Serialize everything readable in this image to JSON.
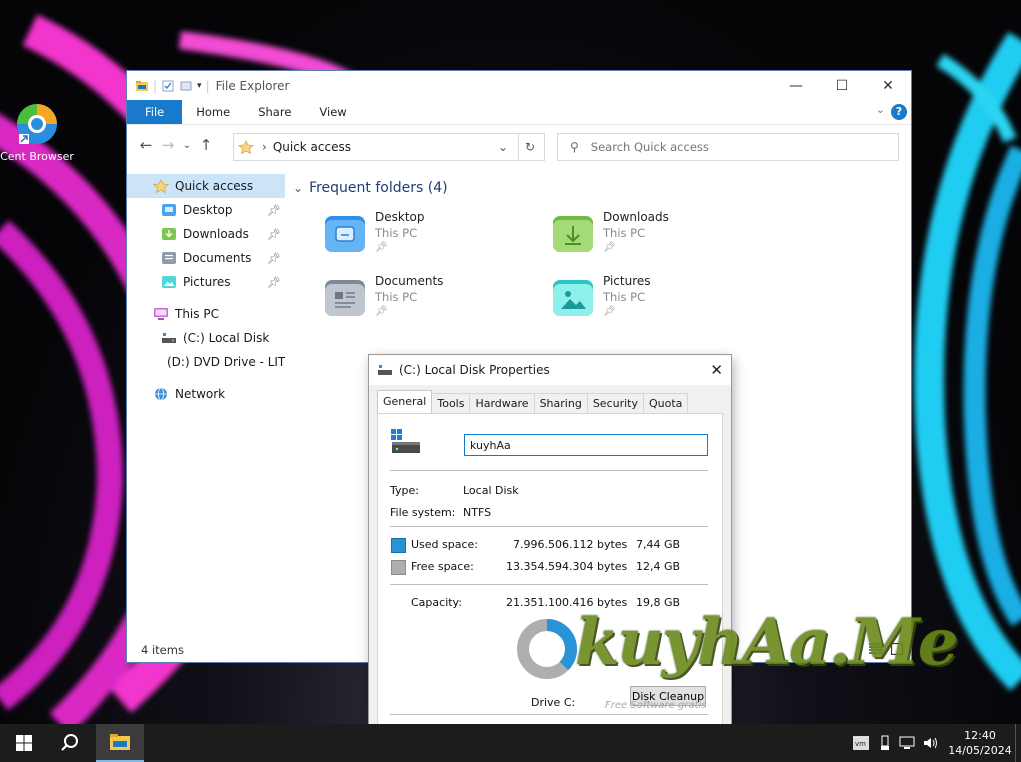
{
  "desktop": {
    "icons": [
      {
        "label": "Cent Browser"
      }
    ]
  },
  "explorer": {
    "title": "File Explorer",
    "window_controls": {
      "minimize": "—",
      "maximize": "☐",
      "close": "✕"
    },
    "ribbon_tabs": [
      "File",
      "Home",
      "Share",
      "View"
    ],
    "address": "Quick access",
    "search_placeholder": "Search Quick access",
    "nav": {
      "quick_access": "Quick access",
      "pinned": [
        "Desktop",
        "Downloads",
        "Documents",
        "Pictures"
      ],
      "this_pc": "This PC",
      "drives": [
        "(C:) Local Disk",
        "(D:) DVD Drive - LIT"
      ],
      "network": "Network"
    },
    "section_title": "Frequent folders (4)",
    "folders": [
      {
        "name": "Desktop",
        "location": "This PC"
      },
      {
        "name": "Downloads",
        "location": "This PC"
      },
      {
        "name": "Documents",
        "location": "This PC"
      },
      {
        "name": "Pictures",
        "location": "This PC"
      }
    ],
    "status": "4 items"
  },
  "props": {
    "title": "(C:) Local Disk Properties",
    "tabs": [
      "General",
      "Tools",
      "Hardware",
      "Sharing",
      "Security",
      "Quota"
    ],
    "name": "kuyhAa",
    "type_label": "Type:",
    "type_value": "Local Disk",
    "fs_label": "File system:",
    "fs_value": "NTFS",
    "used_label": "Used space:",
    "used_bytes": "7.996.506.112 bytes",
    "used_gb": "7,44 GB",
    "free_label": "Free space:",
    "free_bytes": "13.354.594.304 bytes",
    "free_gb": "12,4 GB",
    "cap_label": "Capacity:",
    "cap_bytes": "21.351.100.416 bytes",
    "cap_gb": "19,8 GB",
    "drive_label": "Drive C:",
    "cleanup_label": "Disk Cleanup",
    "used_fraction": 0.3745,
    "used_color": "#2a93d5",
    "free_color": "#aeaeae"
  },
  "watermark": {
    "text": "kuyhAa.Me",
    "sub": "Free Software gratis"
  },
  "taskbar": {
    "time": "12:40",
    "date": "14/05/2024"
  }
}
